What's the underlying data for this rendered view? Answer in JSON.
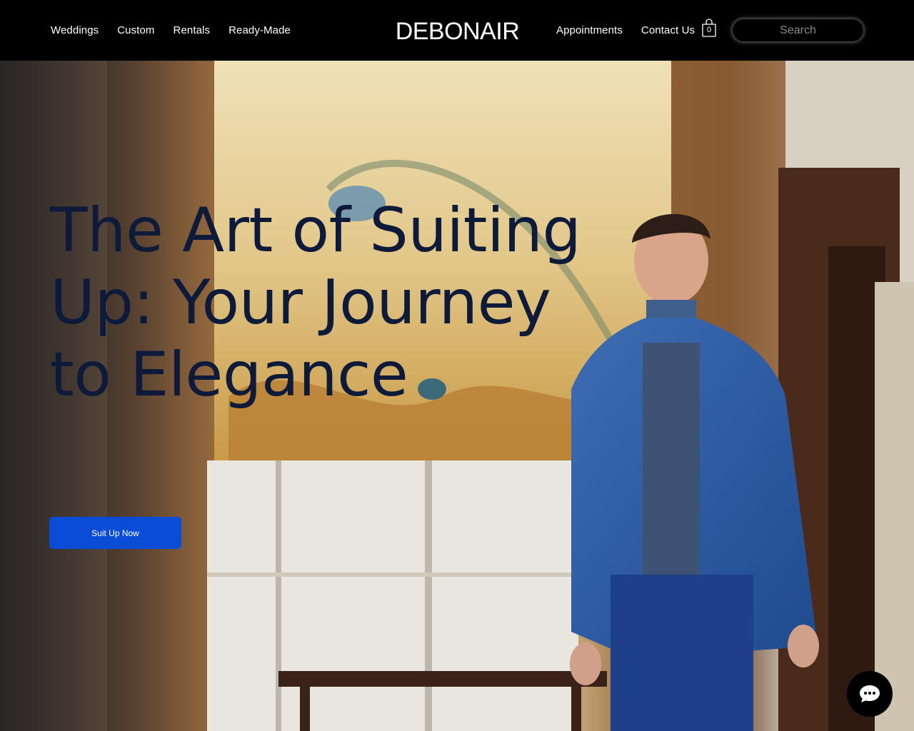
{
  "header": {
    "nav_left": [
      "Weddings",
      "Custom",
      "Rentals",
      "Ready-Made"
    ],
    "logo": "DEBONAIR",
    "nav_right": [
      "Appointments",
      "Contact Us"
    ],
    "cart_count": "0",
    "search_placeholder": "Search"
  },
  "hero": {
    "headline_lines": [
      "The Art of Suiting",
      "Up: Your Journey",
      "to Elegance"
    ],
    "cta_label": "Suit Up Now"
  },
  "icons": {
    "cart": "shopping-bag-icon",
    "chat": "chat-bubble-icon"
  },
  "colors": {
    "header_bg": "#000000",
    "cta_bg": "#0b4cd6",
    "headline_text": "#0e1a3a"
  }
}
